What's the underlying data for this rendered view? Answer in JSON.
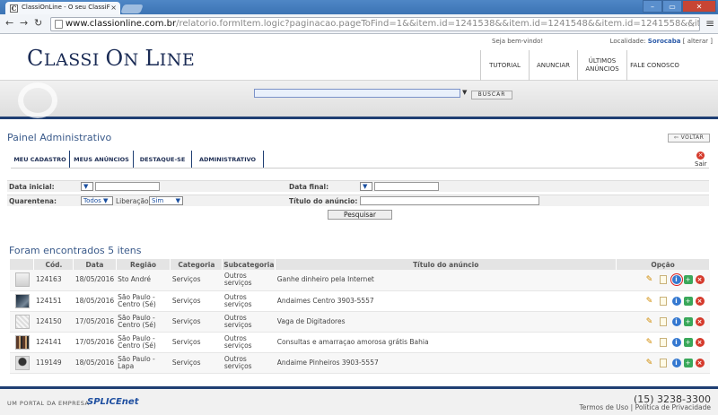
{
  "browser": {
    "tab_title": "ClassiOnLine - O seu ClassiF",
    "tab_close": "×",
    "favicon": "C",
    "url_host": "www.classionline.com.br",
    "url_path": "/relatorio.formItem.logic?paginacao.pageToFind=1&&item.id=1241538&&item.id=1241548&&item.id=1241558&&item.id=1241",
    "window_controls": [
      "–",
      "▭",
      "✕"
    ]
  },
  "header": {
    "logo_c": "C",
    "logo_lassi": "LASSI ",
    "logo_o": "O",
    "logo_n": "N ",
    "logo_l": "L",
    "logo_ine": "INE",
    "welcome": "Seja bem-vindo!",
    "location_label": "Localidade:",
    "location_city": "Sorocaba",
    "location_change": "[ alterar ]",
    "nav": [
      "TUTORIAL",
      "ANUNCIAR",
      "ÚLTIMOS\nANÚNCIOS",
      "FALE CONOSCO"
    ],
    "search_button": "BUSCAR"
  },
  "panel": {
    "title": "Painel Administrativo",
    "back_button": "⇦ VOLTAR",
    "tabs": [
      "MEU CADASTRO",
      "MEUS ANÚNCIOS",
      "DESTAQUE-SE",
      "ADMINISTRATIVO"
    ],
    "logout": "Sair"
  },
  "filters": {
    "date_start_label": "Data inicial:",
    "date_end_label": "Data final:",
    "quarantine_label": "Quarentena:",
    "quarantine_value": "Todos ▼",
    "release_label": "Liberação",
    "release_value": "Sim",
    "release_arrow": "▼",
    "title_label": "Título do anúncio:",
    "date_picker": "▼",
    "search_button": "Pesquisar"
  },
  "results": {
    "summary": "Foram encontrados 5 itens",
    "columns": [
      "",
      "Cód.",
      "Data",
      "Região",
      "Categoria",
      "Subcategoria",
      "Título do anúncio",
      "Opção"
    ],
    "rows": [
      {
        "code": "124163",
        "date": "18/05/2016",
        "region": "Sto André",
        "category": "Serviços",
        "subcategory": "Outros serviços",
        "title": "Ganhe dinheiro pela Internet"
      },
      {
        "code": "124151",
        "date": "18/05/2016",
        "region": "São Paulo - Centro (Sé)",
        "category": "Serviços",
        "subcategory": "Outros serviços",
        "title": "Andaimes Centro 3903-5557"
      },
      {
        "code": "124150",
        "date": "17/05/2016",
        "region": "São Paulo - Centro (Sé)",
        "category": "Serviços",
        "subcategory": "Outros serviços",
        "title": "Vaga de Digitadores"
      },
      {
        "code": "124141",
        "date": "17/05/2016",
        "region": "São Paulo - Centro (Sé)",
        "category": "Serviços",
        "subcategory": "Outros serviços",
        "title": "Consultas e amarraçao amorosa grátis Bahia"
      },
      {
        "code": "119149",
        "date": "18/05/2016",
        "region": "São Paulo - Lapa",
        "category": "Serviços",
        "subcategory": "Outros serviços",
        "title": "Andaime Pinheiros 3903-5557"
      }
    ],
    "action_icons": {
      "edit": "✎",
      "info": "i",
      "feature": "+",
      "delete": "×"
    }
  },
  "footer": {
    "portal": "UM PORTAL DA EMPRESA",
    "brand": "SPLICEnet",
    "phone": "(15) 3238-3300",
    "links": "Termos de Uso | Política de Privacidade"
  }
}
